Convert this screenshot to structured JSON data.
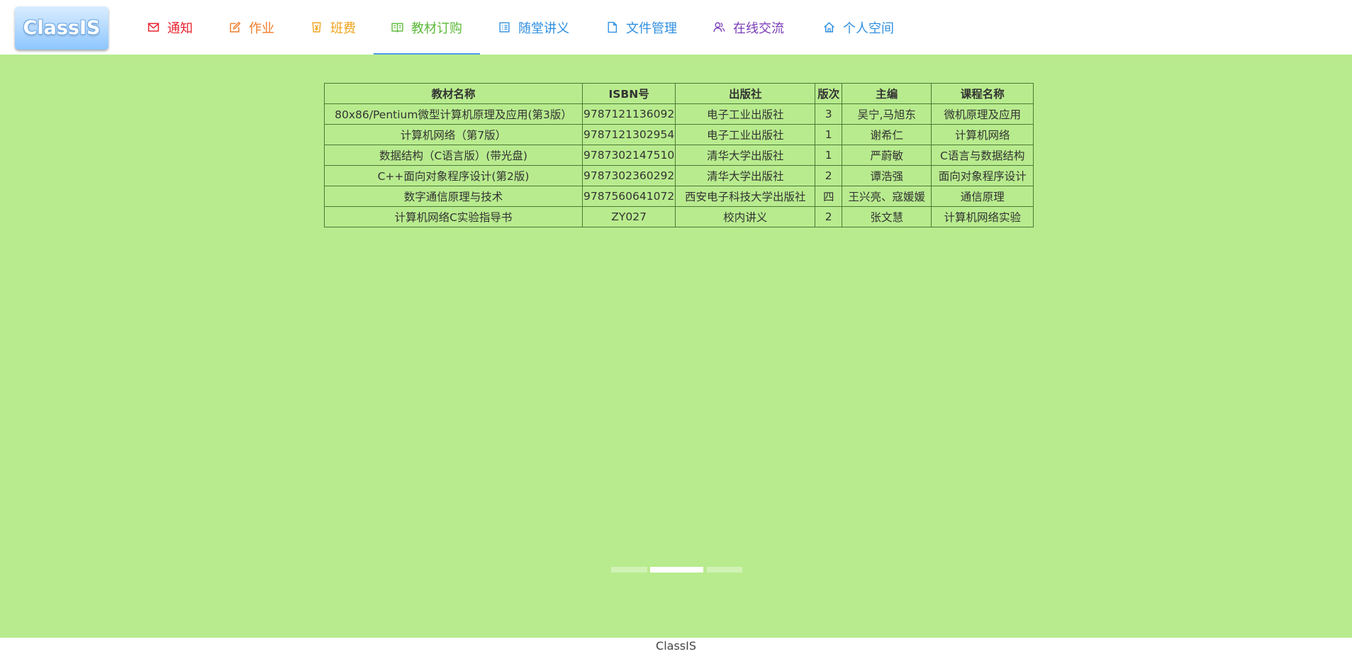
{
  "app": {
    "logo_text": "ClassIS"
  },
  "nav": {
    "items": [
      {
        "label": "通知",
        "icon": "mail-icon",
        "color": "#e8232e"
      },
      {
        "label": "作业",
        "icon": "edit-icon",
        "color": "#f07c2a"
      },
      {
        "label": "班费",
        "icon": "money-icon",
        "color": "#f0a21a"
      },
      {
        "label": "教材订购",
        "icon": "book-icon",
        "color": "#5bb938",
        "active": true
      },
      {
        "label": "随堂讲义",
        "icon": "list-icon",
        "color": "#2f8fe0"
      },
      {
        "label": "文件管理",
        "icon": "file-icon",
        "color": "#2f8fe0"
      },
      {
        "label": "在线交流",
        "icon": "people-icon",
        "color": "#7a3bb8"
      },
      {
        "label": "个人空间",
        "icon": "home-icon",
        "color": "#2f8fe0"
      }
    ],
    "active_color": "#4a9de8"
  },
  "table": {
    "headers": [
      "教材名称",
      "ISBN号",
      "出版社",
      "版次",
      "主编",
      "课程名称"
    ],
    "rows": [
      [
        "80x86/Pentium微型计算机原理及应用(第3版）",
        "9787121136092",
        "电子工业出版社",
        "3",
        "吴宁,马旭东",
        "微机原理及应用"
      ],
      [
        "计算机网络（第7版）",
        "9787121302954",
        "电子工业出版社",
        "1",
        "谢希仁",
        "计算机网络"
      ],
      [
        "数据结构（C语言版）(带光盘)",
        "9787302147510",
        "清华大学出版社",
        "1",
        "严蔚敏",
        "C语言与数据结构"
      ],
      [
        "C++面向对象程序设计(第2版)",
        "9787302360292",
        "清华大学出版社",
        "2",
        "谭浩强",
        "面向对象程序设计"
      ],
      [
        "数字通信原理与技术",
        "9787560641072",
        "西安电子科技大学出版社",
        "四",
        "王兴亮、寇媛媛",
        "通信原理"
      ],
      [
        "计算机网络C实验指导书",
        "ZY027",
        "校内讲义",
        "2",
        "张文慧",
        "计算机网络实验"
      ]
    ]
  },
  "carousel": {
    "slide_count": 3,
    "active_index": 1
  },
  "footer": {
    "text": "ClassIS"
  },
  "colors": {
    "main_background": "#b8eb8e",
    "table_border": "#4a7a35"
  }
}
